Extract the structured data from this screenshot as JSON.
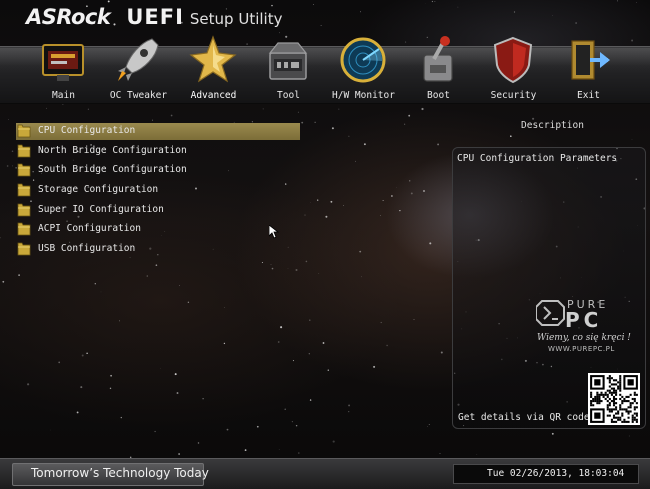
{
  "header": {
    "brand": "ASRock",
    "uefi": "UEFI",
    "subtitle": "Setup Utility"
  },
  "tabs": [
    {
      "label": "Main",
      "icon": "main-board-icon"
    },
    {
      "label": "OC Tweaker",
      "icon": "rocket-icon"
    },
    {
      "label": "Advanced",
      "icon": "star-icon"
    },
    {
      "label": "Tool",
      "icon": "toolbox-icon"
    },
    {
      "label": "H/W Monitor",
      "icon": "radar-icon"
    },
    {
      "label": "Boot",
      "icon": "boot-switch-icon"
    },
    {
      "label": "Security",
      "icon": "shield-icon"
    },
    {
      "label": "Exit",
      "icon": "exit-door-icon"
    }
  ],
  "active_tab": "Advanced",
  "items": [
    {
      "label": "CPU Configuration",
      "selected": true
    },
    {
      "label": "North Bridge Configuration",
      "selected": false
    },
    {
      "label": "South Bridge Configuration",
      "selected": false
    },
    {
      "label": "Storage Configuration",
      "selected": false
    },
    {
      "label": "Super IO Configuration",
      "selected": false
    },
    {
      "label": "ACPI Configuration",
      "selected": false
    },
    {
      "label": "USB Configuration",
      "selected": false
    }
  ],
  "description": {
    "title": "Description",
    "text": "CPU Configuration Parameters",
    "qr_text": "Get details via QR code"
  },
  "watermark": {
    "pure": "PURE",
    "pc": "PC",
    "slogan": "Wiemy, co się kręci !",
    "url": "WWW.PUREPC.PL"
  },
  "footer": {
    "slogan": "Tomorrow’s Technology Today",
    "datetime": "Tue 02/26/2013, 18:03:04"
  },
  "colors": {
    "selection": "#8a7a45",
    "menubar": "#2a2a2c",
    "folder": "#c9a83a"
  }
}
